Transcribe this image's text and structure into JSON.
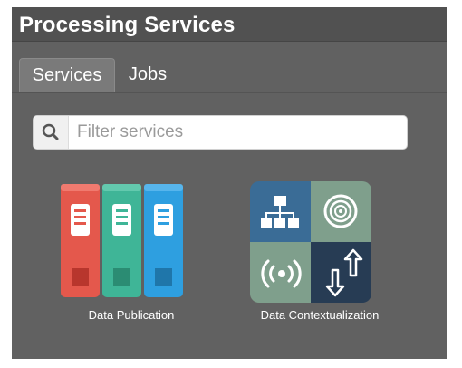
{
  "header": {
    "title": "Processing Services"
  },
  "tabs": [
    {
      "label": "Services",
      "active": true
    },
    {
      "label": "Jobs",
      "active": false
    }
  ],
  "search": {
    "placeholder": "Filter services",
    "value": ""
  },
  "services": [
    {
      "label": "Data Publication",
      "icon": "binders-icon"
    },
    {
      "label": "Data Contextualization",
      "icon": "contextualization-grid-icon"
    }
  ],
  "colors": {
    "panel": "#616161",
    "header": "#515151",
    "binder_red": "#e4584c",
    "binder_green": "#3fb597",
    "binder_blue": "#2e9fe0",
    "tile_blue": "#3a6c96",
    "tile_sage": "#7f9f8c",
    "tile_navy": "#273c54"
  }
}
